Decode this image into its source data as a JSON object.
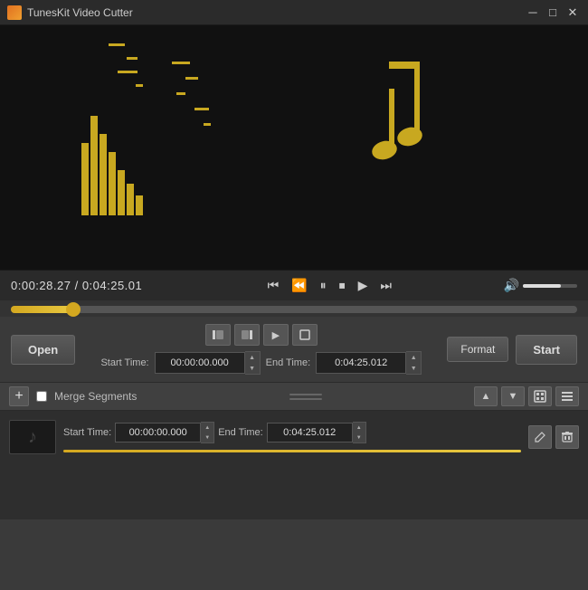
{
  "titleBar": {
    "appName": "TunesKit Video Cutter",
    "minimizeLabel": "─",
    "maximizeLabel": "□",
    "closeLabel": "✕"
  },
  "statusBar": {
    "currentTime": "0:00:28.27",
    "totalTime": "0:04:25.01",
    "timeSeparator": " / "
  },
  "controls": {
    "openLabel": "Open",
    "startLabel": "Start",
    "formatLabel": "Format",
    "startTimeLabel": "Start Time:",
    "endTimeLabel": "End Time:",
    "startTimeValue": "00:00:00.000",
    "endTimeValue": "0:04:25.012"
  },
  "segments": {
    "addLabel": "+",
    "mergeLabel": "Merge Segments",
    "segmentStartLabel": "Start Time:",
    "segmentEndLabel": "End Time:",
    "segmentStartValue": "00:00:00.000",
    "segmentEndValue": "0:04:25.012"
  },
  "seekBar": {
    "progressPercent": 11
  }
}
